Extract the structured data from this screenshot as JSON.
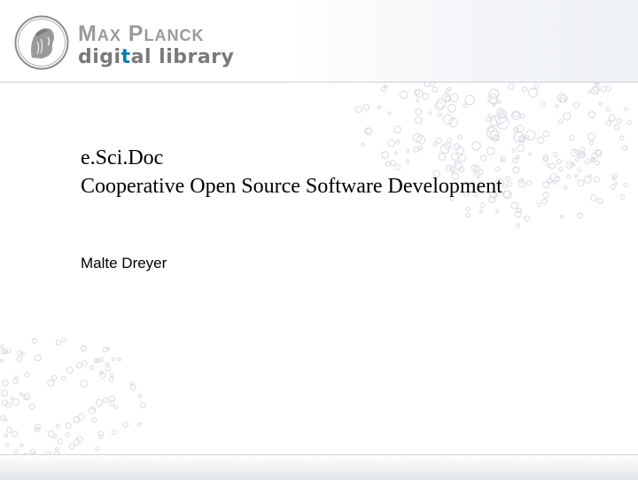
{
  "logo": {
    "line1": "Max Planck",
    "line2_part1": "digi",
    "line2_accent": "t",
    "line2_part2": "al library",
    "accent_color": "#0b7fb0"
  },
  "slide": {
    "title_line1": "e.Sci.Doc",
    "title_line2": "Cooperative Open Source Software Development",
    "author": "Malte Dreyer"
  }
}
